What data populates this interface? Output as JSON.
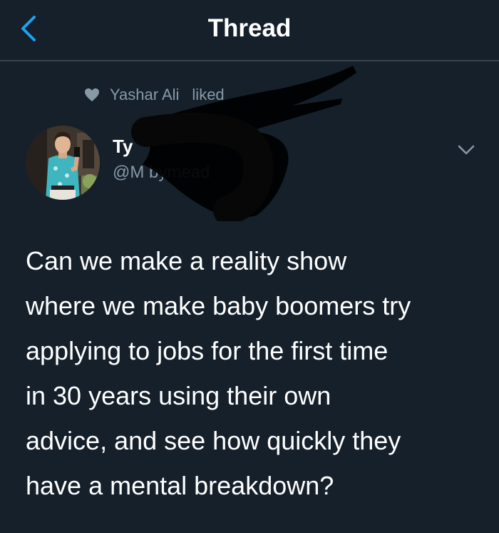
{
  "header": {
    "title": "Thread",
    "back_icon": "chevron-left-icon"
  },
  "social_context": {
    "icon": "heart-icon",
    "name": "Yashar Ali",
    "action": "liked"
  },
  "tweet": {
    "display_name": "Ty",
    "handle": "@M    bymead",
    "text": "Can we make a reality show\nwhere we make baby boomers try\napplying to jobs for the first time\nin 30 years using their own\nadvice, and see how quickly they\nhave a mental breakdown?",
    "menu_icon": "chevron-down-icon"
  },
  "colors": {
    "background": "#15202b",
    "accent": "#1da1f2",
    "secondary_text": "#8899a6",
    "divider": "#38444d"
  }
}
